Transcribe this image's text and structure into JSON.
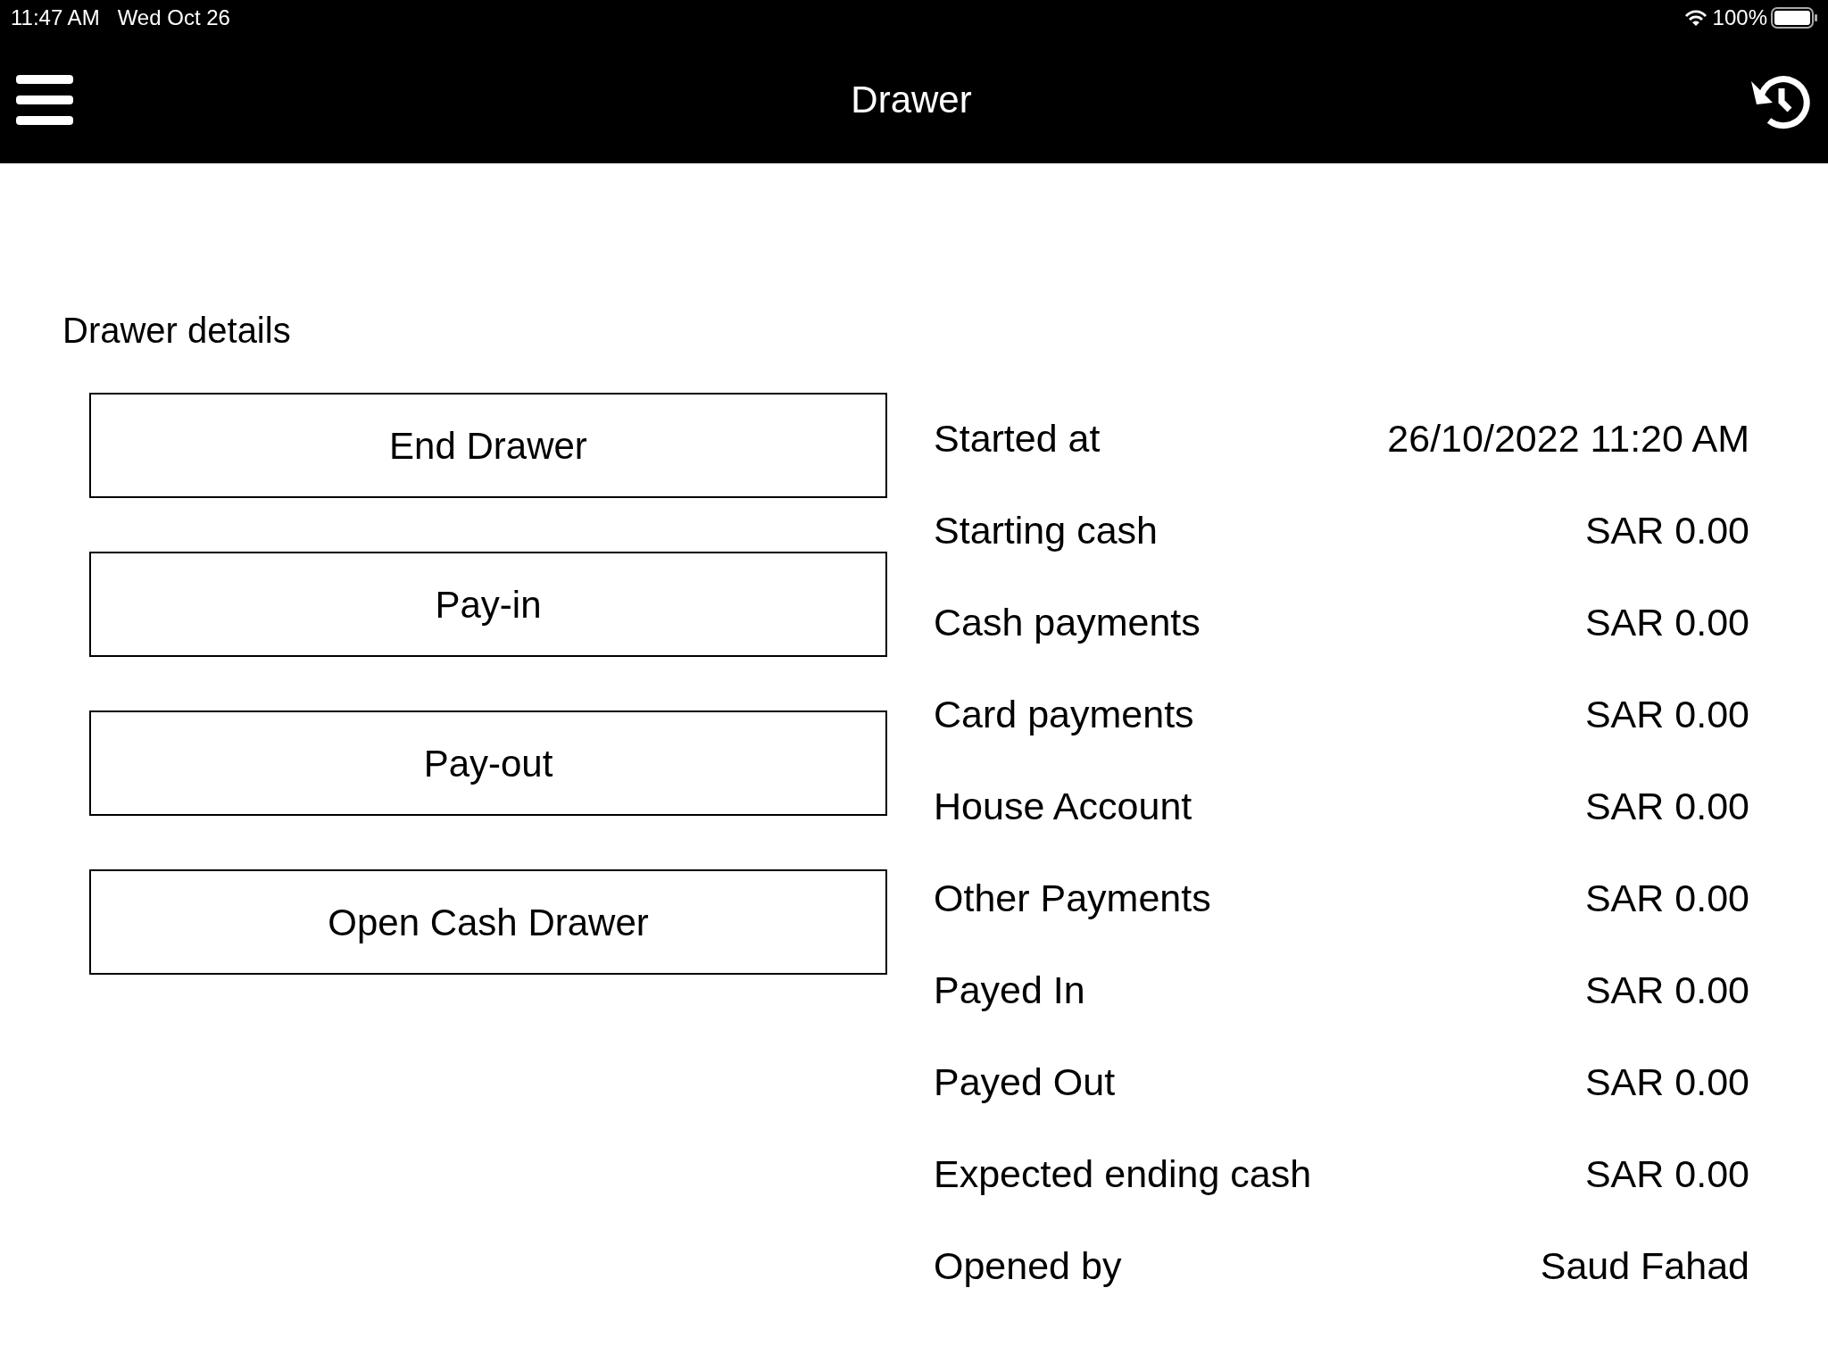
{
  "status_bar": {
    "time": "11:47 AM",
    "date": "Wed Oct 26",
    "battery": "100%"
  },
  "header": {
    "title": "Drawer"
  },
  "section_title": "Drawer details",
  "actions": [
    "End Drawer",
    "Pay-in",
    "Pay-out",
    "Open Cash Drawer"
  ],
  "details": [
    {
      "label": "Started at",
      "value": "26/10/2022 11:20 AM"
    },
    {
      "label": "Starting cash",
      "value": "SAR 0.00"
    },
    {
      "label": "Cash payments",
      "value": "SAR 0.00"
    },
    {
      "label": "Card payments",
      "value": "SAR 0.00"
    },
    {
      "label": "House Account",
      "value": "SAR 0.00"
    },
    {
      "label": "Other Payments",
      "value": "SAR 0.00"
    },
    {
      "label": "Payed In",
      "value": "SAR 0.00"
    },
    {
      "label": "Payed Out",
      "value": "SAR 0.00"
    },
    {
      "label": "Expected ending cash",
      "value": "SAR 0.00"
    },
    {
      "label": "Opened by",
      "value": "Saud Fahad"
    }
  ]
}
